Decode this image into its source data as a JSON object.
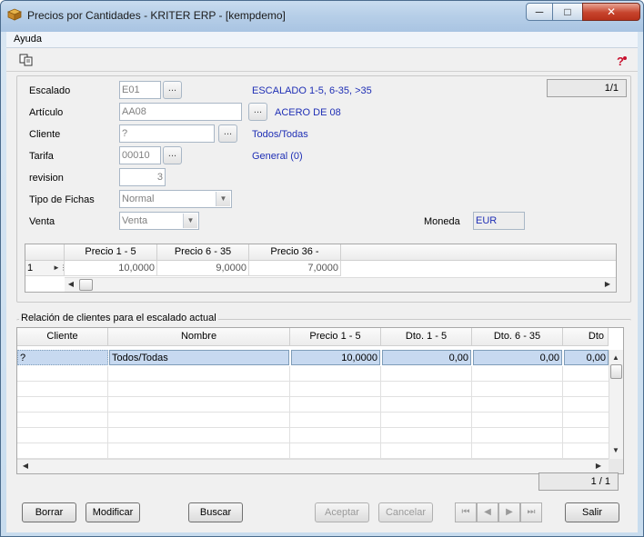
{
  "window": {
    "title": "Precios por Cantidades - KRITER ERP - [kempdemo]"
  },
  "menu": {
    "items": [
      {
        "label": "Ayuda"
      }
    ]
  },
  "toolbar": {
    "copy_icon": "copy-icon",
    "help_icon": "help-icon"
  },
  "form": {
    "counter": "1/1",
    "escalado": {
      "label": "Escalado",
      "value": "E01",
      "description": "ESCALADO 1-5, 6-35, >35"
    },
    "articulo": {
      "label": "Artículo",
      "value": "AA08",
      "description": "ACERO DE 08"
    },
    "cliente": {
      "label": "Cliente",
      "value": "?",
      "description": "Todos/Todas"
    },
    "tarifa": {
      "label": "Tarifa",
      "value": "00010",
      "description": "General (0)"
    },
    "revision": {
      "label": "revision",
      "value": "3"
    },
    "tipo_fichas": {
      "label": "Tipo de Fichas",
      "value": "Normal"
    },
    "venta": {
      "label": "Venta",
      "value": "Venta"
    },
    "moneda": {
      "label": "Moneda",
      "value": "EUR"
    },
    "lookup_label": "..."
  },
  "price_grid": {
    "columns": [
      "Precio 1 - 5",
      "Precio 6 - 35",
      "Precio 36 -"
    ],
    "rows": [
      {
        "index": "1",
        "values": [
          "10,0000",
          "9,0000",
          "7,0000"
        ]
      }
    ]
  },
  "clients_section": {
    "title": "Relación de clientes para el escalado actual",
    "columns": [
      "Cliente",
      "Nombre",
      "Precio 1 - 5",
      "Dto. 1 - 5",
      "Dto. 6 - 35",
      "Dto"
    ],
    "rows": [
      {
        "cliente": "?",
        "nombre": "Todos/Todas",
        "precio": "10,0000",
        "dto1": "0,00",
        "dto2": "0,00",
        "dto3": "0,00"
      }
    ],
    "counter": "1 / 1"
  },
  "buttons": {
    "borrar": "Borrar",
    "modificar": "Modificar",
    "buscar": "Buscar",
    "aceptar": "Aceptar",
    "cancelar": "Cancelar",
    "salir": "Salir"
  },
  "colors": {
    "accent_blue": "#1f2fb5",
    "selection": "#c7d9f0",
    "close_button": "#c7442d"
  }
}
